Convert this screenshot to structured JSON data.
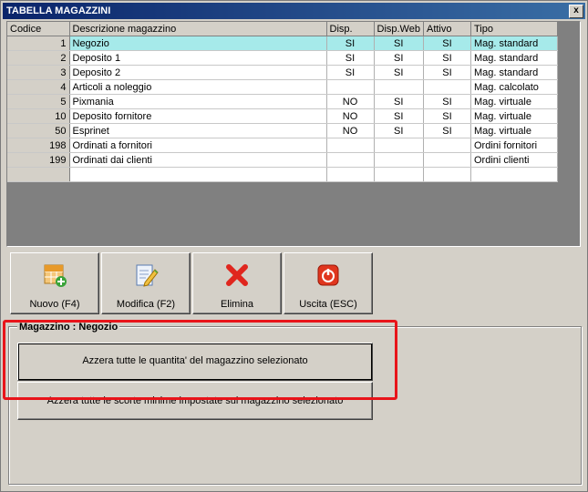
{
  "window": {
    "title": "TABELLA MAGAZZINI",
    "close_label": "x"
  },
  "grid": {
    "headers": [
      "Codice",
      "Descrizione magazzino",
      "Disp.",
      "Disp.Web",
      "Attivo",
      "Tipo"
    ],
    "rows": [
      [
        "1",
        "Negozio",
        "SI",
        "SI",
        "SI",
        "Mag. standard"
      ],
      [
        "2",
        "Deposito 1",
        "SI",
        "SI",
        "SI",
        "Mag. standard"
      ],
      [
        "3",
        "Deposito 2",
        "SI",
        "SI",
        "SI",
        "Mag. standard"
      ],
      [
        "4",
        "Articoli a noleggio",
        "",
        "",
        "",
        "Mag. calcolato"
      ],
      [
        "5",
        "Pixmania",
        "NO",
        "SI",
        "SI",
        "Mag. virtuale"
      ],
      [
        "10",
        "Deposito fornitore",
        "NO",
        "SI",
        "SI",
        "Mag. virtuale"
      ],
      [
        "50",
        "Esprinet",
        "NO",
        "SI",
        "SI",
        "Mag. virtuale"
      ],
      [
        "198",
        "Ordinati a fornitori",
        "",
        "",
        "",
        "Ordini fornitori"
      ],
      [
        "199",
        "Ordinati dai clienti",
        "",
        "",
        "",
        "Ordini clienti"
      ],
      [
        "",
        "",
        "",
        "",
        "",
        ""
      ]
    ],
    "selected_index": 0,
    "selected_color": "#a6eaea"
  },
  "toolbar": {
    "new_label": "Nuovo (F4)",
    "edit_label": "Modifica (F2)",
    "delete_label": "Elimina",
    "exit_label": "Uscita (ESC)",
    "icons": [
      "new-grid-icon",
      "edit-document-icon",
      "delete-x-icon",
      "power-exit-icon"
    ]
  },
  "group": {
    "label": "Magazzino : Negozio",
    "reset_quantities_label": "Azzera tutte le quantita' del magazzino selezionato",
    "reset_min_stock_label": "Azzera tutte le scorte minime impostate sul magazzino selezionato"
  },
  "highlight_color": "#e8141a"
}
